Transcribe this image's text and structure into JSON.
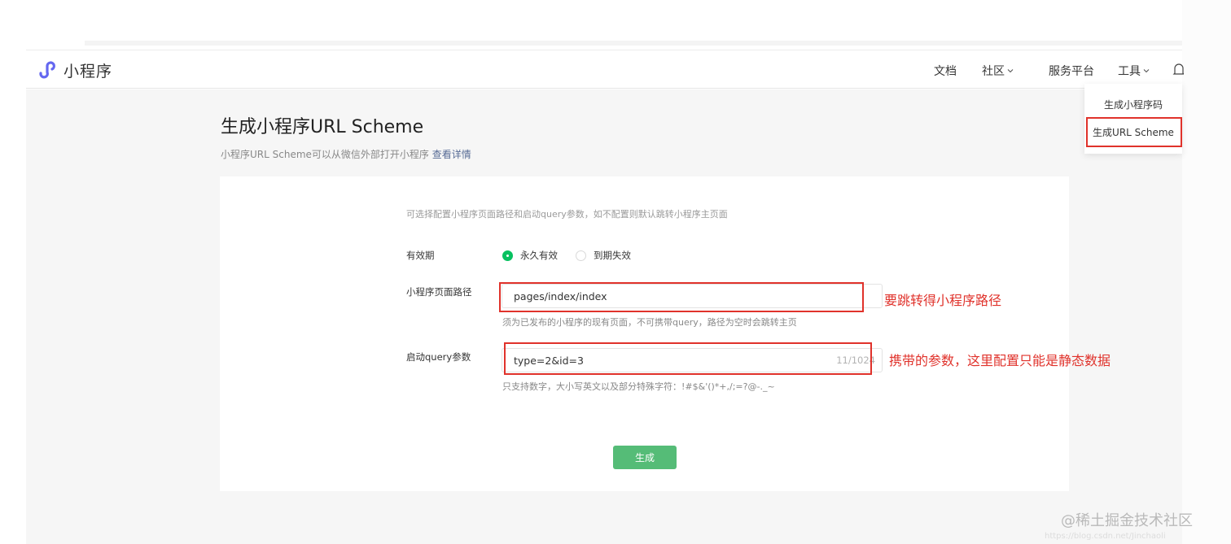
{
  "brand": {
    "name": "小程序",
    "logo_icon": "miniprogram-logo-icon",
    "accent": "#6467f0"
  },
  "nav": {
    "items": [
      {
        "label": "文档",
        "has_chevron": false
      },
      {
        "label": "社区",
        "has_chevron": true
      },
      {
        "label": "服务平台",
        "has_chevron": false
      },
      {
        "label": "工具",
        "has_chevron": true
      }
    ],
    "bell_icon": "bell-icon"
  },
  "tools_dropdown": {
    "items": [
      {
        "label": "生成小程序码"
      },
      {
        "label": "生成URL Scheme",
        "highlighted": true
      }
    ]
  },
  "page": {
    "title": "生成小程序URL Scheme",
    "description": "小程序URL Scheme可以从微信外部打开小程序",
    "details_link": "查看详情"
  },
  "form": {
    "hint": "可选择配置小程序页面路径和启动query参数，如不配置则默认跳转小程序主页面",
    "validity": {
      "label": "有效期",
      "options": [
        {
          "label": "永久有效",
          "checked": true
        },
        {
          "label": "到期失效",
          "checked": false
        }
      ]
    },
    "path": {
      "label": "小程序页面路径",
      "value": "pages/index/index",
      "tip": "须为已发布的小程序的现有页面，不可携带query，路径为空时会跳转主页"
    },
    "query": {
      "label": "启动query参数",
      "value": "type=2&id=3",
      "counter": "11/1024",
      "tip": "只支持数字，大小写英文以及部分特殊字符：!#$&'()*+,/;=?@-._~"
    },
    "submit_label": "生成"
  },
  "annotations": {
    "path_note": "要跳转得小程序路径",
    "query_note": "携带的参数，这里配置只能是静态数据",
    "color": "#e0322b"
  },
  "watermark": {
    "text": "@稀土掘金技术社区",
    "url": "https://blog.csdn.net/Jinchaoli"
  },
  "colors": {
    "primary_green": "#07c160",
    "button_green": "#55bc77",
    "link": "#576b95"
  }
}
